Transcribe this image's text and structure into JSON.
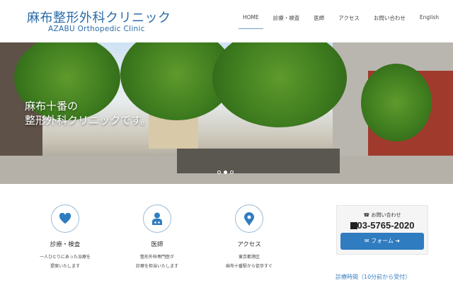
{
  "header": {
    "logo_jp": "麻布整形外科クリニック",
    "logo_en": "AZABU Orthopedic Clinic",
    "nav": [
      {
        "label": "HOME"
      },
      {
        "label": "診療・検査"
      },
      {
        "label": "医師"
      },
      {
        "label": "アクセス"
      },
      {
        "label": "お問い合わせ"
      },
      {
        "label": "English"
      }
    ]
  },
  "hero": {
    "line1": "麻布十番の",
    "line2": "整形外科クリニックです。",
    "slide_count": 3,
    "active_slide": 2
  },
  "features": [
    {
      "icon": "heart-icon",
      "title": "診療・検査",
      "desc1": "一人ひとりにあった治療を",
      "desc2": "提案いたします"
    },
    {
      "icon": "doctor-icon",
      "title": "医師",
      "desc1": "整形外科専門医が",
      "desc2": "診療を担当いたします"
    },
    {
      "icon": "map-pin-icon",
      "title": "アクセス",
      "desc1": "東京都港区",
      "desc2": "麻布十番駅から徒歩すぐ"
    }
  ],
  "contact": {
    "label": "お問い合わせ",
    "tel": "03-5765-2020",
    "form_label": "フォーム"
  },
  "hours_link": "診療時間（10分前から受付）",
  "colors": {
    "brand": "#2a6ba8",
    "button": "#2f7cc0"
  }
}
